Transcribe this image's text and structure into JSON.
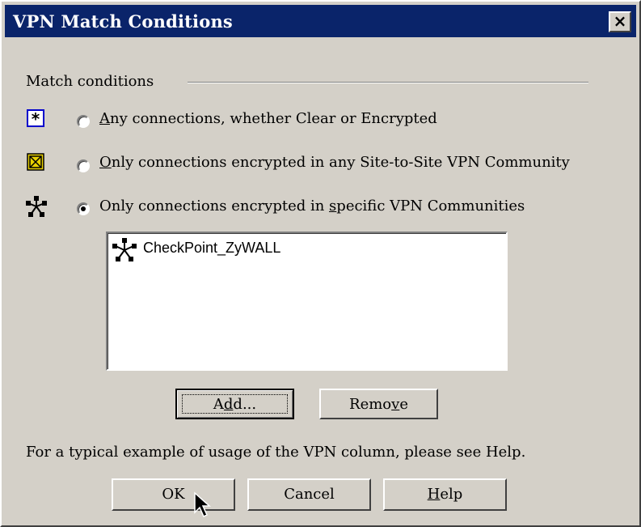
{
  "window": {
    "title": "VPN Match Conditions",
    "close_label": "×"
  },
  "group": {
    "label": "Match conditions"
  },
  "options": [
    {
      "text_pre": "",
      "mnemonic": "A",
      "text_post": "ny connections, whether Clear or Encrypted",
      "checked": false,
      "icon": "star-box-icon"
    },
    {
      "text_pre": "",
      "mnemonic": "O",
      "text_post": "nly connections encrypted in any Site-to-Site VPN Community",
      "checked": false,
      "icon": "crossed-box-icon"
    },
    {
      "text_pre": "Only connections encrypted in ",
      "mnemonic": "s",
      "text_post": "pecific VPN Communities",
      "checked": true,
      "icon": "vpn-community-icon"
    }
  ],
  "communities": [
    {
      "name": "CheckPoint_ZyWALL",
      "icon": "vpn-community-icon"
    }
  ],
  "buttons": {
    "add_pre": "A",
    "add_mn": "d",
    "add_post": "d...",
    "remove_pre": "Remo",
    "remove_mn": "v",
    "remove_post": "e",
    "ok": "OK",
    "cancel": "Cancel",
    "help_mn": "H",
    "help_post": "elp"
  },
  "footer_text": "For a typical example of usage of the VPN column, please see Help.",
  "colors": {
    "titlebar": "#0a246a",
    "face": "#d4d0c8",
    "icon_blue": "#0000cc",
    "icon_yellow": "#e8d000"
  }
}
